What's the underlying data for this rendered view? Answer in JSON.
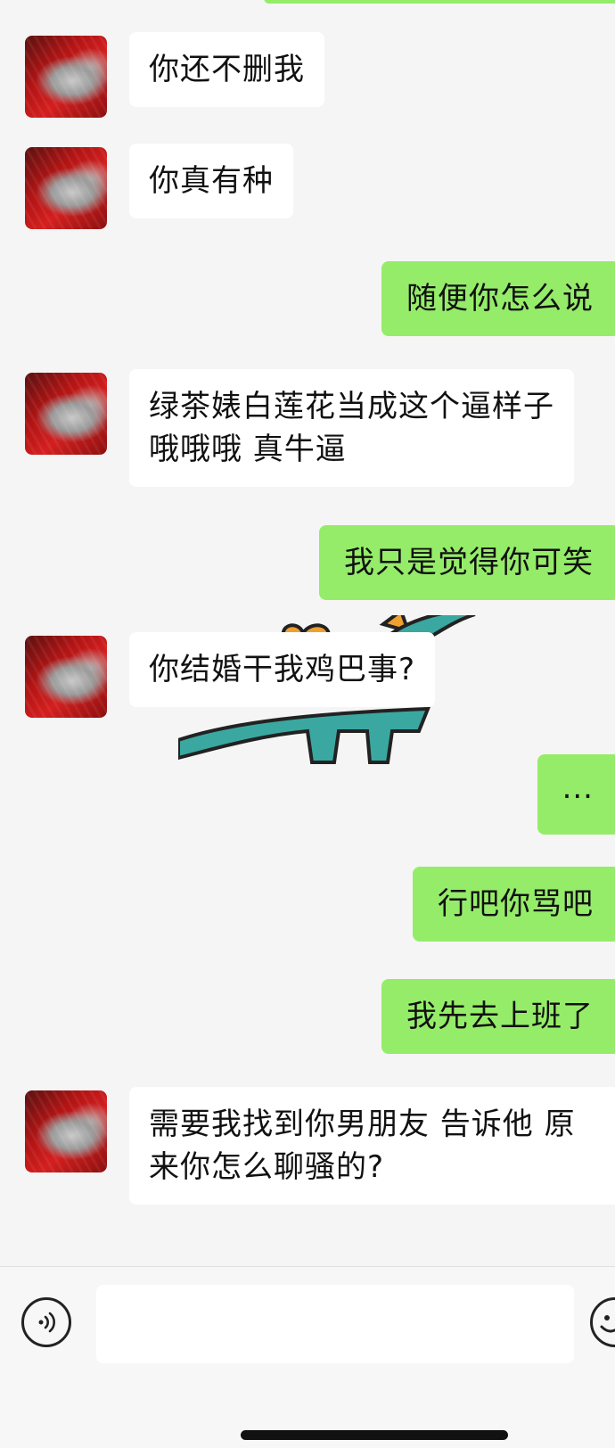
{
  "colors": {
    "sent_bubble": "#95ec69",
    "received_bubble": "#ffffff",
    "background": "#f5f5f5"
  },
  "messages": [
    {
      "side": "left",
      "text": "你还不删我"
    },
    {
      "side": "left",
      "text": "你真有种"
    },
    {
      "side": "right",
      "text": "随便你怎么说"
    },
    {
      "side": "left",
      "lines": [
        "绿茶婊白莲花当成这个逼样子",
        "哦哦哦 真牛逼"
      ]
    },
    {
      "side": "right",
      "text": "我只是觉得你可笑"
    },
    {
      "side": "left",
      "text": "你结婚干我鸡巴事?"
    },
    {
      "side": "right",
      "text": "..."
    },
    {
      "side": "right",
      "text": "行吧你骂吧"
    },
    {
      "side": "right",
      "text": "我先去上班了"
    },
    {
      "side": "left",
      "lines": [
        "需要我找到你男朋友 告诉他 原",
        "来你怎么聊骚的?"
      ]
    }
  ],
  "input_bar": {
    "voice_icon": "voice-icon",
    "emoji_icon": "emoji-icon",
    "input_value": ""
  }
}
